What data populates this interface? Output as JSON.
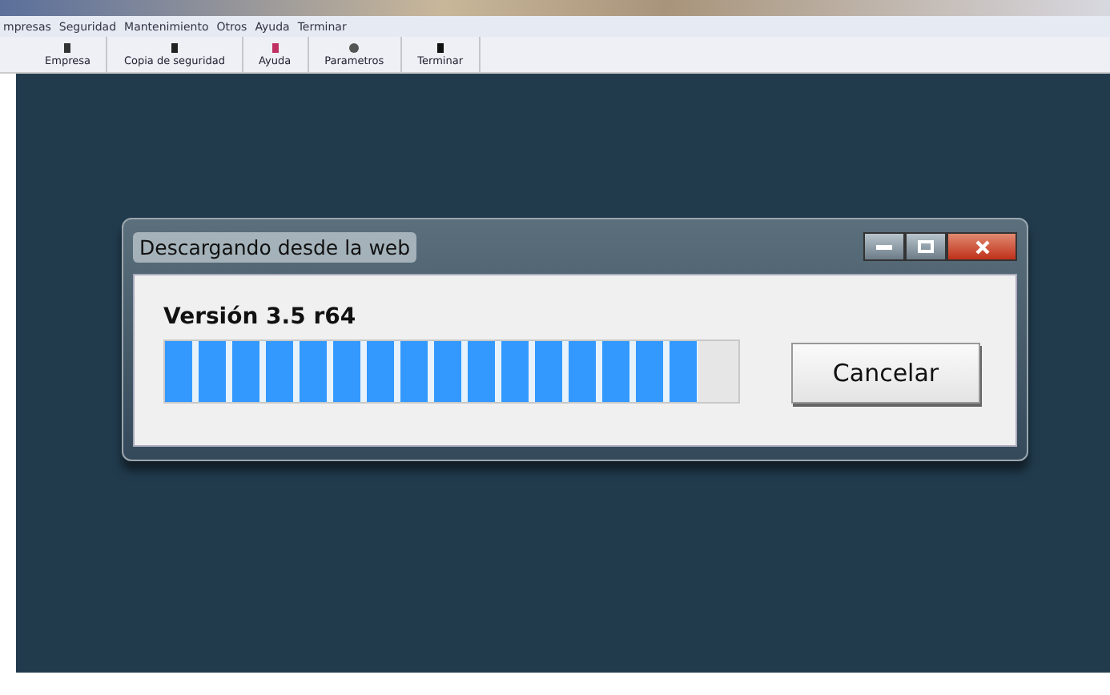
{
  "menu": [
    "mpresas",
    "Seguridad",
    "Mantenimiento",
    "Otros",
    "Ayuda",
    "Terminar"
  ],
  "toolbar": [
    {
      "label": "Empresa"
    },
    {
      "label": "Copia de seguridad"
    },
    {
      "label": "Ayuda"
    },
    {
      "label": "Parametros"
    },
    {
      "label": "Terminar"
    }
  ],
  "dialog": {
    "title": "Descargando desde la web",
    "version": "Versión 3.5 r64",
    "progress": {
      "level": 0.93
    },
    "button": "Cancelar"
  }
}
